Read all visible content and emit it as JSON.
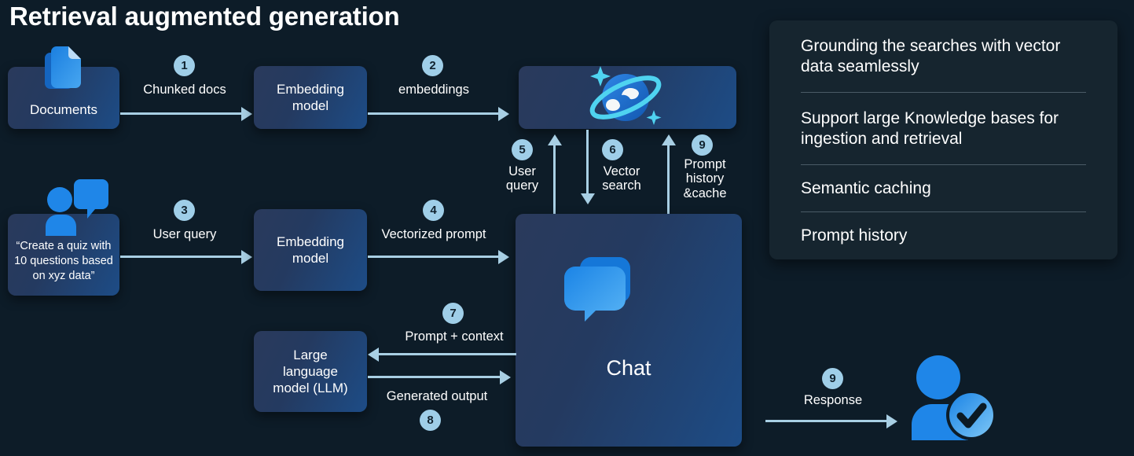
{
  "title": "Retrieval augmented generation",
  "nodes": {
    "documents": "Documents",
    "embedding_model_1": "Embedding\nmodel",
    "cosmos": "",
    "user_prompt": "“Create a quiz with 10 questions based on xyz data”",
    "embedding_model_2": "Embedding\nmodel",
    "chat": "Chat",
    "llm": "Large\nlanguage\nmodel (LLM)"
  },
  "flows": [
    {
      "num": "1",
      "label": "Chunked docs"
    },
    {
      "num": "2",
      "label": "embeddings"
    },
    {
      "num": "3",
      "label": "User query"
    },
    {
      "num": "4",
      "label": "Vectorized prompt"
    },
    {
      "num": "5",
      "label": "User\nquery"
    },
    {
      "num": "6",
      "label": "Vector\nsearch"
    },
    {
      "num": "7",
      "label": "Prompt + context"
    },
    {
      "num": "8",
      "label": "Generated output"
    },
    {
      "num": "9",
      "label": "Prompt\nhistory\n&cache"
    },
    {
      "num": "9",
      "label": "Response"
    }
  ],
  "panel": {
    "features": [
      "Grounding the searches with vector data seamlessly",
      "Support large Knowledge bases for ingestion and retrieval",
      "Semantic caching",
      "Prompt history"
    ]
  },
  "icons": {
    "documents": "documents-icon",
    "user_chat": "user-chat-icon",
    "cosmos": "cosmos-planet-icon",
    "chat": "chat-bubbles-icon",
    "response_user": "user-verified-icon"
  },
  "colors": {
    "background": "#0d1c28",
    "arrow": "#a8cfe4",
    "badge": "#9fcee8",
    "panel": "#16252f",
    "icon_blue": "#1f86e8",
    "accent_cyan": "#4fd3f0"
  }
}
